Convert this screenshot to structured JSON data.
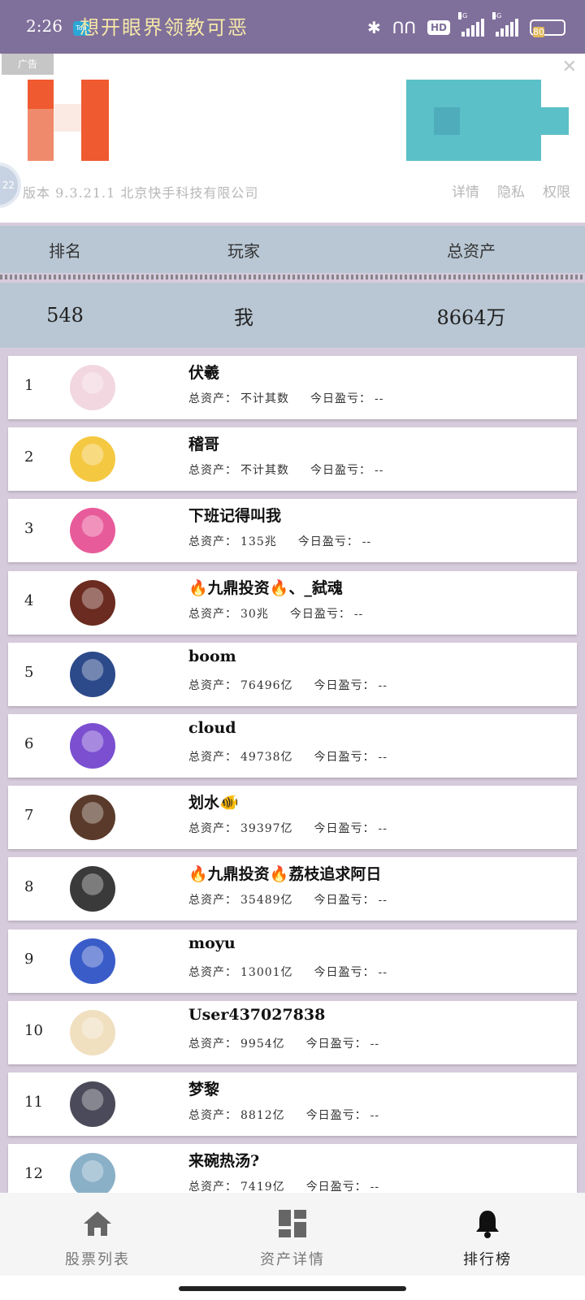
{
  "status_bar": {
    "time": "2:26",
    "app_badge": "Top",
    "title": "想开眼界领教可恶",
    "hd_label": "HD",
    "net1": "5G",
    "net2": "5G",
    "battery": "80"
  },
  "ad": {
    "label": "广告",
    "avatar_text": "22",
    "meta": "版本 9.3.21.1  北京快手科技有限公司",
    "links": [
      "详情",
      "隐私",
      "权限"
    ]
  },
  "table_header": {
    "rank": "排名",
    "player": "玩家",
    "assets": "总资产"
  },
  "my_row": {
    "rank": "548",
    "player": "我",
    "assets": "8664万"
  },
  "labels": {
    "total_assets": "总资产：",
    "today_pl": "今日盈亏："
  },
  "rows": [
    {
      "rank": "1",
      "name": "伏羲",
      "assets": "不计其数",
      "today": "--"
    },
    {
      "rank": "2",
      "name": "稽哥",
      "assets": "不计其数",
      "today": "--"
    },
    {
      "rank": "3",
      "name": "下班记得叫我",
      "assets": "135兆",
      "today": "--"
    },
    {
      "rank": "4",
      "name": "🔥九鼎投资🔥、_弑魂",
      "assets": "30兆",
      "today": "--"
    },
    {
      "rank": "5",
      "name": "boom",
      "assets": "76496亿",
      "today": "--"
    },
    {
      "rank": "6",
      "name": "cloud",
      "assets": "49738亿",
      "today": "--"
    },
    {
      "rank": "7",
      "name": "划水🐠",
      "assets": "39397亿",
      "today": "--"
    },
    {
      "rank": "8",
      "name": "🔥九鼎投资🔥荔枝追求阿日",
      "assets": "35489亿",
      "today": "--"
    },
    {
      "rank": "9",
      "name": "moyu",
      "assets": "13001亿",
      "today": "--"
    },
    {
      "rank": "10",
      "name": "User437027838",
      "assets": "9954亿",
      "today": "--"
    },
    {
      "rank": "11",
      "name": "梦黎",
      "assets": "8812亿",
      "today": "--"
    },
    {
      "rank": "12",
      "name": "来碗热汤?",
      "assets": "7419亿",
      "today": "--"
    }
  ],
  "bottom_nav": [
    {
      "label": "股票列表",
      "icon": "home-icon"
    },
    {
      "label": "资产详情",
      "icon": "dashboard-icon"
    },
    {
      "label": "排行榜",
      "icon": "bell-icon"
    }
  ]
}
